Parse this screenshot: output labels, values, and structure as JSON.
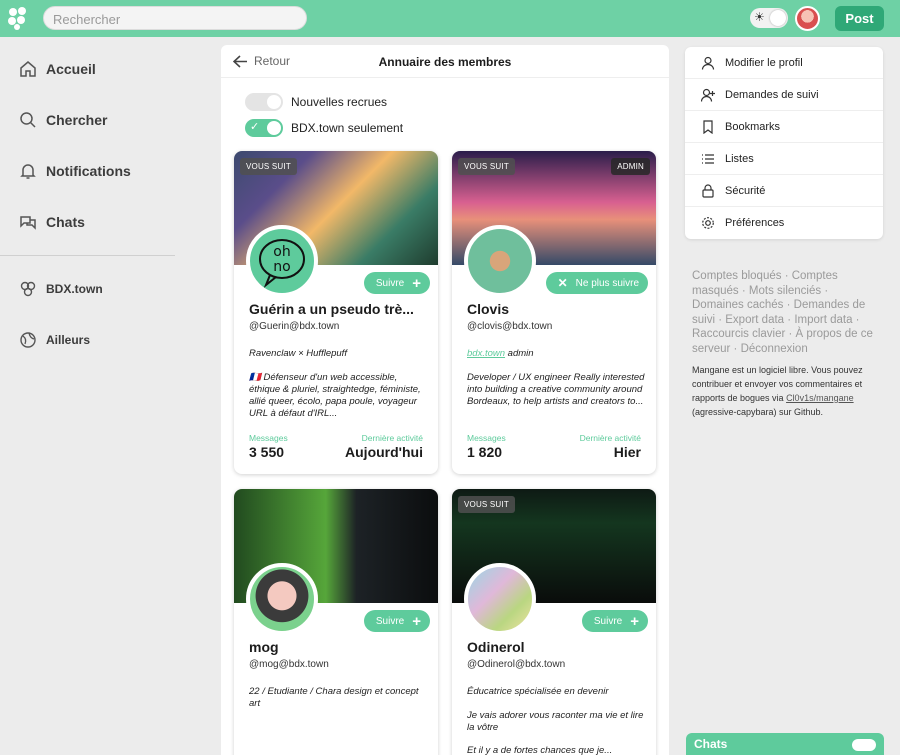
{
  "search": {
    "placeholder": "Rechercher"
  },
  "header": {
    "post_label": "Post"
  },
  "sidebar": {
    "items": [
      {
        "label": "Accueil"
      },
      {
        "label": "Chercher"
      },
      {
        "label": "Notifications"
      },
      {
        "label": "Chats"
      }
    ],
    "instances": [
      {
        "label": "BDX.town"
      },
      {
        "label": "Ailleurs"
      }
    ]
  },
  "main": {
    "back_label": "Retour",
    "title": "Annuaire des membres",
    "toggles": [
      {
        "label": "Nouvelles recrues",
        "on": false
      },
      {
        "label": "BDX.town seulement",
        "on": true
      }
    ],
    "stats_labels": {
      "messages": "Messages",
      "activity": "Dernière activité"
    },
    "members": [
      {
        "tag": "VOUS SUIT",
        "avatar_text": "oh no",
        "follow_label": "Suivre",
        "name": "Guérin a un pseudo trè...",
        "handle": "@Guerin@bdx.town",
        "bio1": "Ravenclaw × Hufflepuff",
        "bio2": "🇫🇷 Défenseur d'un web accessible, éthique & pluriel, straightedge, féministe, allié queer, écolo, papa poule, voyageur URL à défaut d'IRL...",
        "messages": "3 550",
        "activity": "Aujourd'hui"
      },
      {
        "tag": "VOUS SUIT",
        "admin_tag": "ADMIN",
        "follow_label": "Ne plus suivre",
        "name": "Clovis",
        "handle": "@clovis@bdx.town",
        "bio1_link": "bdx.town",
        "bio1_rest": " admin",
        "bio2": "Developer / UX engineer Really interested into building a creative community around Bordeaux, to help artists and creators to...",
        "messages": "1 820",
        "activity": "Hier"
      },
      {
        "follow_label": "Suivre",
        "name": "mog",
        "handle": "@mog@bdx.town",
        "bio1": "22 / Etudiante / Chara design et concept art"
      },
      {
        "tag": "VOUS SUIT",
        "follow_label": "Suivre",
        "name": "Odinerol",
        "handle": "@Odinerol@bdx.town",
        "bio1": "Éducatrice spécialisée en devenir",
        "bio2": "Je vais adorer vous raconter ma vie et lire la vôtre",
        "bio3": "Et il y a de fortes chances que je..."
      }
    ]
  },
  "right": {
    "menu": [
      {
        "label": "Modifier le profil",
        "icon": "user-icon"
      },
      {
        "label": "Demandes de suivi",
        "icon": "user-plus-icon"
      },
      {
        "label": "Bookmarks",
        "icon": "bookmark-icon"
      },
      {
        "label": "Listes",
        "icon": "list-icon"
      },
      {
        "label": "Sécurité",
        "icon": "lock-icon"
      },
      {
        "label": "Préférences",
        "icon": "gear-icon"
      }
    ],
    "links": [
      "Comptes bloqués",
      "Comptes masqués",
      "Mots silenciés",
      "Domaines cachés",
      "Demandes de suivi",
      "Export data",
      "Import data",
      "Raccourcis clavier",
      "À propos de ce serveur",
      "Déconnexion"
    ],
    "footnote_a": "Mangane est un logiciel libre. Vous pouvez contribuer et envoyer vos commentaires et rapports de bogues via ",
    "footnote_link": "Cl0v1s/mangane",
    "footnote_b": " (agressive-capybara) sur Github.",
    "chat_label": "Chats"
  },
  "colors": {
    "accent": "#6ed1a5",
    "button": "#2fa877",
    "follow": "#5ecb9c"
  }
}
